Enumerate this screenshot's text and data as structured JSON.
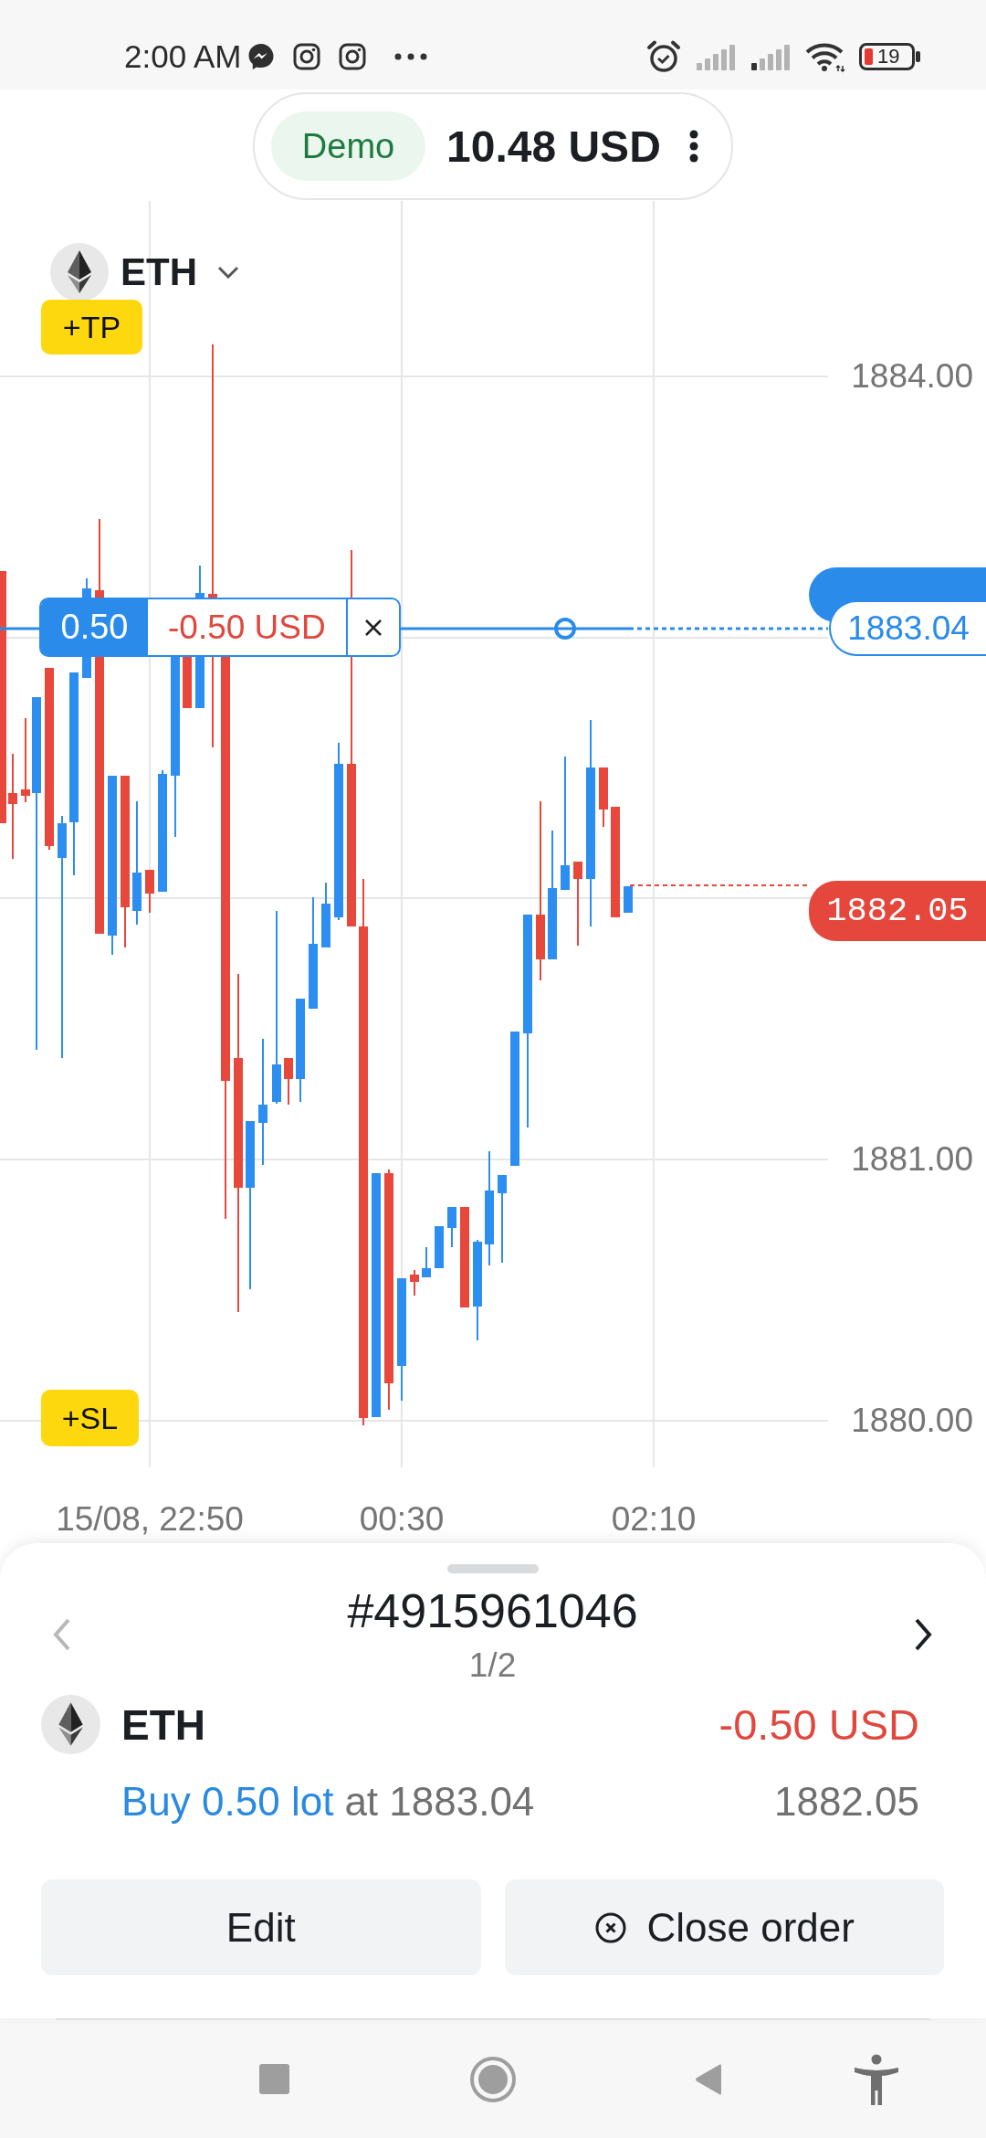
{
  "status_bar": {
    "time": "2:00 AM",
    "battery": "19"
  },
  "account": {
    "mode": "Demo",
    "balance": "10.48 USD"
  },
  "instrument": {
    "symbol": "ETH"
  },
  "chart": {
    "take_profit": "+TP",
    "stop_loss": "+SL",
    "price_ticks": [
      "1884.00",
      "1881.00",
      "1880.00"
    ],
    "time_ticks": [
      "15/08, 22:50",
      "00:30",
      "02:10"
    ],
    "position": {
      "volume": "0.50",
      "profit": "-0.50 USD",
      "entry_price": "1883.04"
    },
    "current_price": "1882.05"
  },
  "order_panel": {
    "order_number": "#4915961046",
    "pager": "1/2",
    "previous": {
      "disabled": true
    },
    "next": {
      "disabled": false
    },
    "symbol": "ETH",
    "profit": "-0.50 USD",
    "trade": "Buy 0.50 lot",
    "entry": "at 1883.04",
    "current_price": "1882.05",
    "actions": [
      {
        "kind": "edit",
        "label": "Edit"
      },
      {
        "kind": "close",
        "label": "Close order"
      }
    ]
  }
}
